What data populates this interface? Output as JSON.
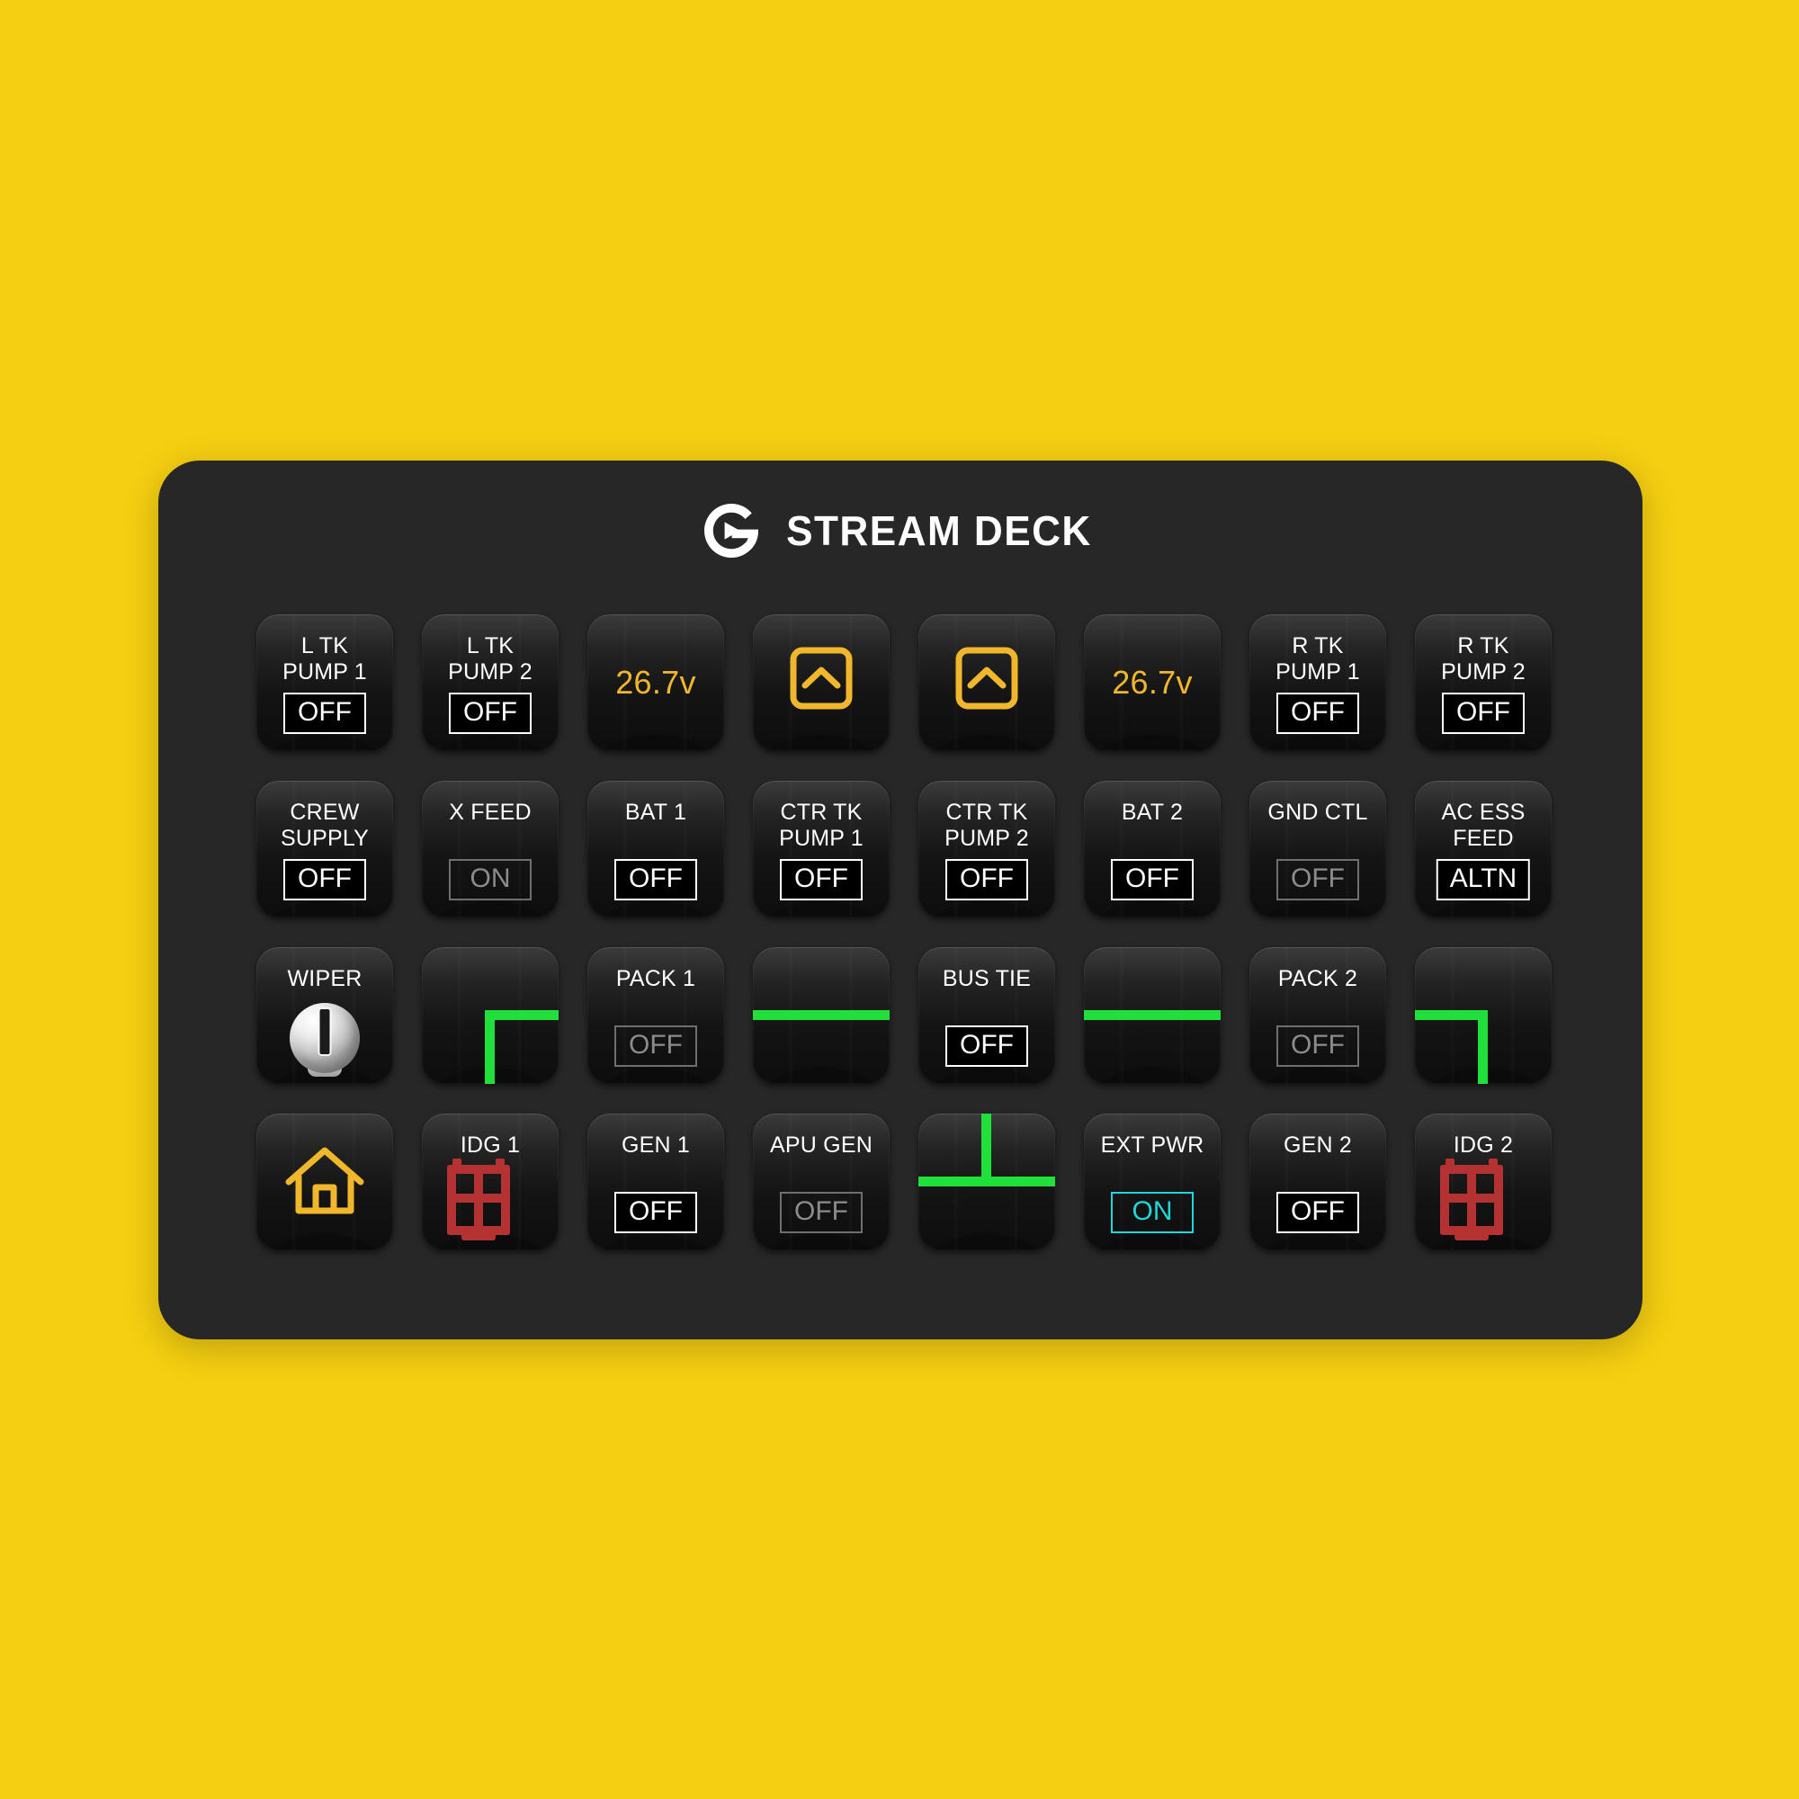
{
  "background_color": "#f5cf11",
  "deck": {
    "body_color": "#272727",
    "brand": {
      "logo_icon": "elgato-logo-icon",
      "wordmark": "STREAM DECK"
    }
  },
  "colors": {
    "amber": "#f0b72c",
    "green": "#22e03c",
    "cyan": "#1fd8dd",
    "red": "#b53232",
    "white": "#ffffff",
    "dim": "#8c8c8c"
  },
  "grid": {
    "columns": 8,
    "rows": 4
  },
  "keys": [
    {
      "id": "l-tk-pump-1",
      "row": 1,
      "col": 1,
      "type": "label-value",
      "label": "L TK\nPUMP 1",
      "value": "OFF",
      "value_state": "active"
    },
    {
      "id": "l-tk-pump-2",
      "row": 1,
      "col": 2,
      "type": "label-value",
      "label": "L TK\nPUMP 2",
      "value": "OFF",
      "value_state": "active"
    },
    {
      "id": "left-voltage",
      "row": 1,
      "col": 3,
      "type": "voltage",
      "value": "26.7v"
    },
    {
      "id": "left-chevron-up",
      "row": 1,
      "col": 4,
      "type": "icon",
      "icon": "chevron-up-boxed-icon"
    },
    {
      "id": "right-chevron-up",
      "row": 1,
      "col": 5,
      "type": "icon",
      "icon": "chevron-up-boxed-icon"
    },
    {
      "id": "right-voltage",
      "row": 1,
      "col": 6,
      "type": "voltage",
      "value": "26.7v"
    },
    {
      "id": "r-tk-pump-1",
      "row": 1,
      "col": 7,
      "type": "label-value",
      "label": "R TK\nPUMP 1",
      "value": "OFF",
      "value_state": "active"
    },
    {
      "id": "r-tk-pump-2",
      "row": 1,
      "col": 8,
      "type": "label-value",
      "label": "R TK\nPUMP 2",
      "value": "OFF",
      "value_state": "active"
    },
    {
      "id": "crew-supply",
      "row": 2,
      "col": 1,
      "type": "label-value",
      "label": "CREW\nSUPPLY",
      "value": "OFF",
      "value_state": "active"
    },
    {
      "id": "x-feed",
      "row": 2,
      "col": 2,
      "type": "label-value",
      "label": "X FEED",
      "value": "ON",
      "value_state": "dim"
    },
    {
      "id": "bat-1",
      "row": 2,
      "col": 3,
      "type": "label-value",
      "label": "BAT 1",
      "value": "OFF",
      "value_state": "active"
    },
    {
      "id": "ctr-tk-pump-1",
      "row": 2,
      "col": 4,
      "type": "label-value",
      "label": "CTR TK\nPUMP 1",
      "value": "OFF",
      "value_state": "active"
    },
    {
      "id": "ctr-tk-pump-2",
      "row": 2,
      "col": 5,
      "type": "label-value",
      "label": "CTR TK\nPUMP 2",
      "value": "OFF",
      "value_state": "active"
    },
    {
      "id": "bat-2",
      "row": 2,
      "col": 6,
      "type": "label-value",
      "label": "BAT 2",
      "value": "OFF",
      "value_state": "active"
    },
    {
      "id": "gnd-ctl",
      "row": 2,
      "col": 7,
      "type": "label-value",
      "label": "GND CTL",
      "value": "OFF",
      "value_state": "dim"
    },
    {
      "id": "ac-ess-feed",
      "row": 2,
      "col": 8,
      "type": "label-value",
      "label": "AC ESS\nFEED",
      "value": "ALTN",
      "value_state": "active"
    },
    {
      "id": "wiper",
      "row": 3,
      "col": 1,
      "type": "knob",
      "label": "WIPER",
      "icon": "rotary-knob-icon"
    },
    {
      "id": "bus-elbow-left",
      "row": 3,
      "col": 2,
      "type": "schematic",
      "icon": "bus-elbow-down-right-icon"
    },
    {
      "id": "pack-1",
      "row": 3,
      "col": 3,
      "type": "label-value",
      "label": "PACK 1",
      "value": "OFF",
      "value_state": "dim"
    },
    {
      "id": "bus-line-left",
      "row": 3,
      "col": 4,
      "type": "schematic",
      "icon": "bus-line-horizontal-icon"
    },
    {
      "id": "bus-tie",
      "row": 3,
      "col": 5,
      "type": "label-value",
      "label": "BUS TIE",
      "value": "OFF",
      "value_state": "active"
    },
    {
      "id": "bus-line-right",
      "row": 3,
      "col": 6,
      "type": "schematic",
      "icon": "bus-line-horizontal-icon"
    },
    {
      "id": "pack-2",
      "row": 3,
      "col": 7,
      "type": "label-value",
      "label": "PACK 2",
      "value": "OFF",
      "value_state": "dim"
    },
    {
      "id": "bus-elbow-right",
      "row": 3,
      "col": 8,
      "type": "schematic",
      "icon": "bus-elbow-left-down-icon"
    },
    {
      "id": "home",
      "row": 4,
      "col": 1,
      "type": "icon",
      "icon": "home-icon"
    },
    {
      "id": "idg-1",
      "row": 4,
      "col": 2,
      "type": "label-icon",
      "label": "IDG 1",
      "icon": "idg-grid-icon"
    },
    {
      "id": "gen-1",
      "row": 4,
      "col": 3,
      "type": "label-value",
      "label": "GEN 1",
      "value": "OFF",
      "value_state": "active"
    },
    {
      "id": "apu-gen",
      "row": 4,
      "col": 4,
      "type": "label-value",
      "label": "APU GEN",
      "value": "OFF",
      "value_state": "dim"
    },
    {
      "id": "bus-tee",
      "row": 4,
      "col": 5,
      "type": "schematic",
      "icon": "bus-tee-up-icon"
    },
    {
      "id": "ext-pwr",
      "row": 4,
      "col": 6,
      "type": "label-value",
      "label": "EXT PWR",
      "value": "ON",
      "value_state": "cyan"
    },
    {
      "id": "gen-2",
      "row": 4,
      "col": 7,
      "type": "label-value",
      "label": "GEN 2",
      "value": "OFF",
      "value_state": "active"
    },
    {
      "id": "idg-2",
      "row": 4,
      "col": 8,
      "type": "label-icon",
      "label": "IDG 2",
      "icon": "idg-grid-icon"
    }
  ]
}
